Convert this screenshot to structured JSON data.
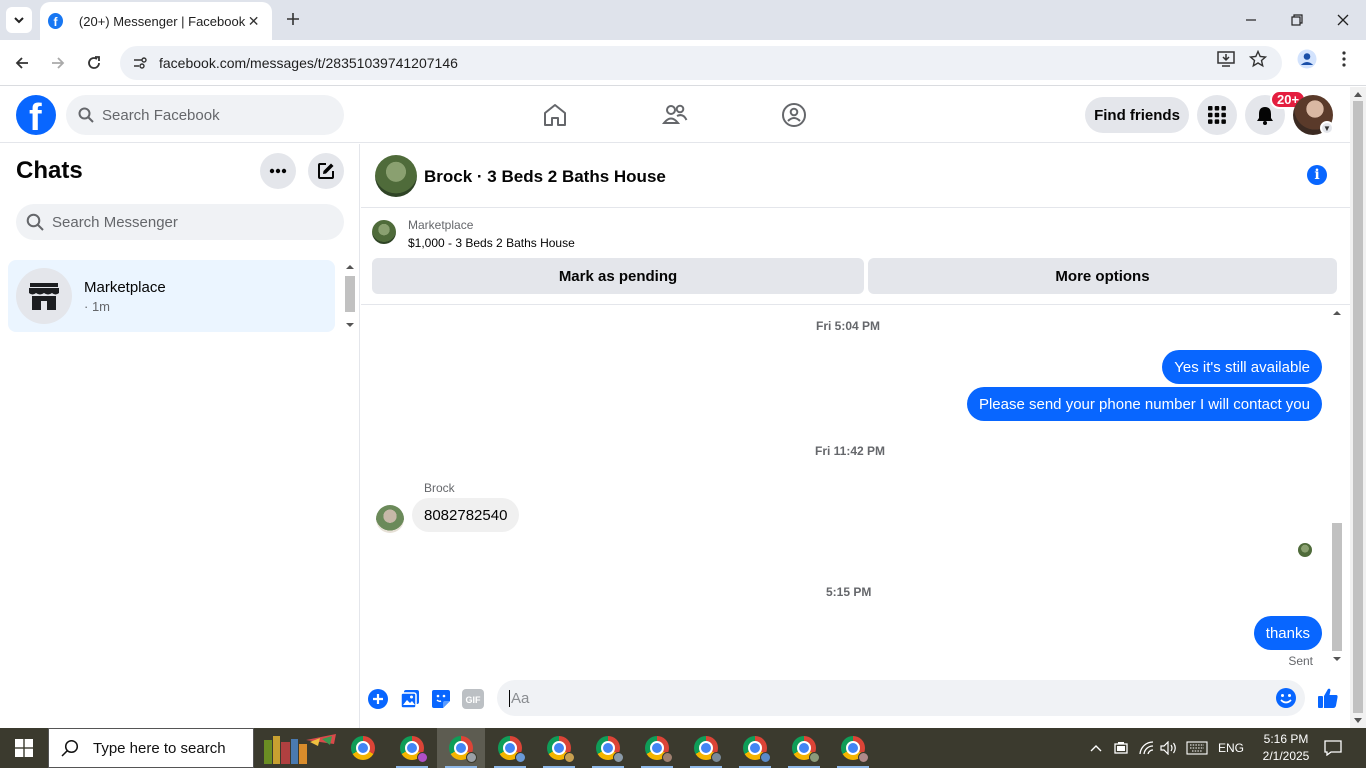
{
  "browser": {
    "tab_title": "(20+) Messenger | Facebook",
    "tab_favicon": "f",
    "url": "facebook.com/messages/t/28351039741207146"
  },
  "fb_header": {
    "logo": "f",
    "search_placeholder": "Search Facebook",
    "find_friends_label": "Find friends",
    "notification_badge": "20+",
    "brand_color": "#0866ff"
  },
  "chats": {
    "title": "Chats",
    "search_placeholder": "Search Messenger",
    "items": [
      {
        "name": "Marketplace",
        "subtitle": "· 1m",
        "icon": "storefront-icon"
      }
    ]
  },
  "conversation": {
    "title": "Brock · 3 Beds 2 Baths House",
    "listing": {
      "label": "Marketplace",
      "item": "$1,000 - 3 Beds 2 Baths House",
      "mark_pending_label": "Mark as pending",
      "more_options_label": "More options"
    },
    "messages": [
      {
        "type": "timestamp",
        "text": "Fri 5:04 PM"
      },
      {
        "type": "outgoing",
        "text": "Yes it's still available"
      },
      {
        "type": "outgoing",
        "text": "Please send your phone number I will contact you"
      },
      {
        "type": "timestamp",
        "text": "Fri 11:42 PM"
      },
      {
        "type": "sender",
        "text": "Brock"
      },
      {
        "type": "incoming",
        "text": "8082782540"
      },
      {
        "type": "timestamp",
        "text": "5:15 PM"
      },
      {
        "type": "outgoing",
        "text": "thanks"
      },
      {
        "type": "status",
        "text": "Sent"
      }
    ],
    "composer_placeholder": "Aa"
  },
  "taskbar": {
    "search_placeholder": "Type here to search",
    "language": "ENG",
    "time": "5:16 PM",
    "date": "2/1/2025"
  }
}
